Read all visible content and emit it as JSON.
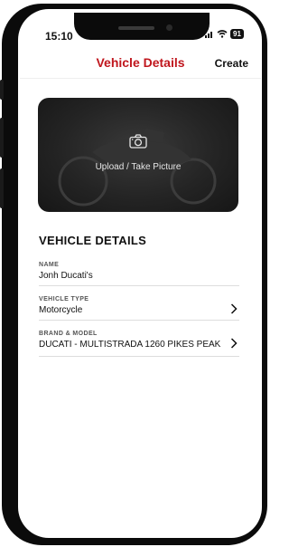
{
  "status_bar": {
    "time": "15:10",
    "battery": "91"
  },
  "nav": {
    "title": "Vehicle Details",
    "action": "Create"
  },
  "upload": {
    "label": "Upload / Take Picture"
  },
  "section": {
    "title": "VEHICLE DETAILS"
  },
  "fields": [
    {
      "label": "NAME",
      "value": "Jonh Ducati's"
    },
    {
      "label": "VEHICLE TYPE",
      "value": "Motorcycle"
    },
    {
      "label": "BRAND & MODEL",
      "value": "DUCATI - MULTISTRADA 1260 PIKES PEAK"
    }
  ],
  "colors": {
    "accent": "#c0161d",
    "frame": "#0b0b0b"
  },
  "icons": {
    "camera": "camera-icon",
    "chevron": "chevron-right-icon"
  }
}
